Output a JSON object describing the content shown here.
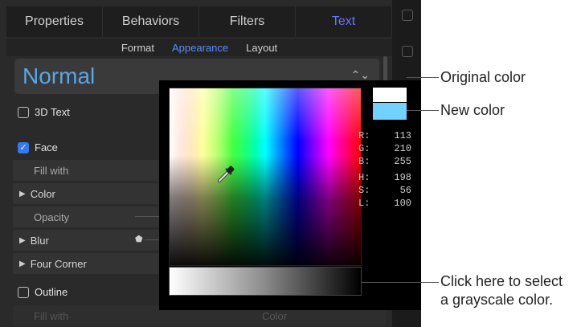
{
  "tabs": [
    {
      "label": "Properties",
      "active": false
    },
    {
      "label": "Behaviors",
      "active": false
    },
    {
      "label": "Filters",
      "active": false
    },
    {
      "label": "Text",
      "active": true
    }
  ],
  "subtabs": [
    {
      "label": "Format",
      "active": false
    },
    {
      "label": "Appearance",
      "active": true
    },
    {
      "label": "Layout",
      "active": false
    }
  ],
  "preset": {
    "value": "Normal",
    "chevron_icon": "up-down-chevron-icon"
  },
  "rows": {
    "text3d": {
      "label": "3D Text",
      "checked": false
    },
    "face": {
      "label": "Face",
      "checked": true
    },
    "fill_with": "Fill with",
    "color": "Color",
    "opacity": "Opacity",
    "blur": "Blur",
    "four_corner": "Four Corner",
    "outline": {
      "label": "Outline",
      "checked": false
    },
    "outline_fill_with": "Fill with",
    "outline_fill_value": "Color"
  },
  "picker": {
    "original_color": "#ffffff",
    "new_color": "#71d2ff",
    "values": {
      "r_label": "R:",
      "r": "113",
      "g_label": "G:",
      "g": "210",
      "b_label": "B:",
      "b": "255",
      "h_label": "H:",
      "h": "198",
      "s_label": "S:",
      "s": "56",
      "l_label": "L:",
      "l": "100"
    }
  },
  "callouts": {
    "original": "Original color",
    "new": "New color",
    "gray_line1": "Click here to select",
    "gray_line2": "a grayscale color."
  }
}
